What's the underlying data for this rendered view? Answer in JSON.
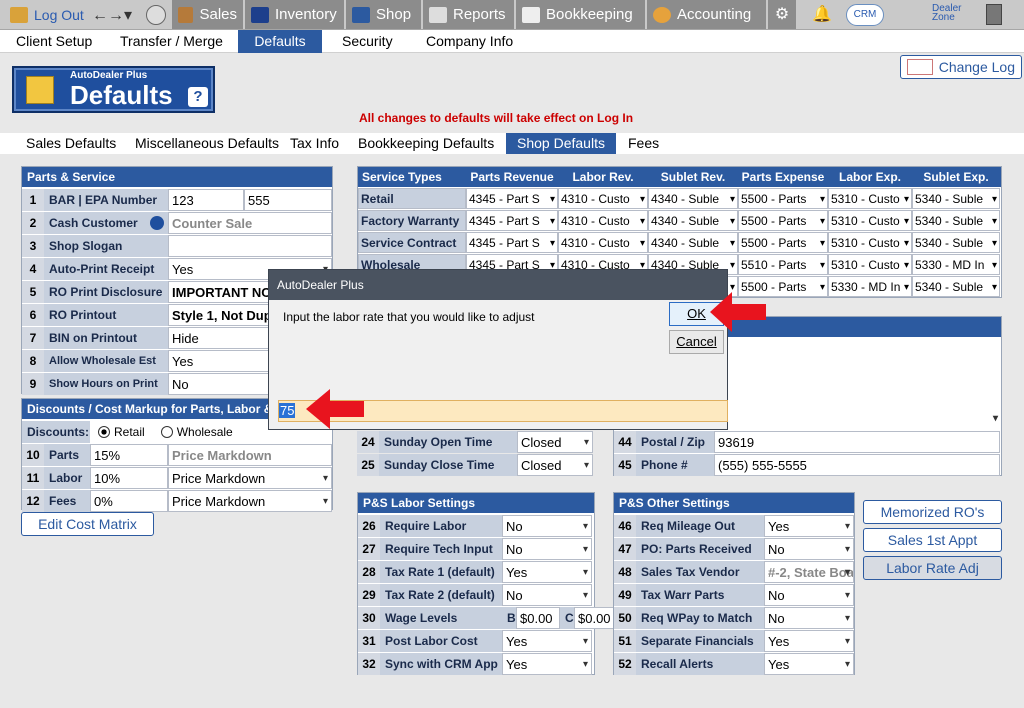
{
  "nav": {
    "logout": "Log Out",
    "sales": "Sales",
    "inventory": "Inventory",
    "shop": "Shop",
    "reports": "Reports",
    "bookkeeping": "Bookkeeping",
    "accounting": "Accounting",
    "crm": "CRM",
    "dealer_zone": "Dealer Zone"
  },
  "subtabs": [
    "Client Setup",
    "Transfer / Merge",
    "Defaults",
    "Security",
    "Company Info"
  ],
  "logo": {
    "small": "AutoDealer Plus",
    "big": "Defaults",
    "help": "?"
  },
  "notice": "All changes to defaults will take effect on Log In",
  "change_log": "Change Log",
  "deftabs": [
    "Sales Defaults",
    "Miscellaneous Defaults",
    "Tax Info",
    "Bookkeeping Defaults",
    "Shop Defaults",
    "Fees"
  ],
  "parts": {
    "title": "Parts & Service",
    "rows": [
      {
        "n": "1",
        "label": "BAR | EPA Number",
        "v1": "123",
        "v2": "555"
      },
      {
        "n": "2",
        "label": "Cash Customer",
        "value": "Counter Sale"
      },
      {
        "n": "3",
        "label": "Shop Slogan",
        "value": ""
      },
      {
        "n": "4",
        "label": "Auto-Print Receipt",
        "value": "Yes"
      },
      {
        "n": "5",
        "label": "RO Print Disclosure",
        "value": "IMPORTANT NO"
      },
      {
        "n": "6",
        "label": "RO Printout",
        "value": "Style 1, Not Dup"
      },
      {
        "n": "7",
        "label": "BIN on Printout",
        "value": "Hide"
      },
      {
        "n": "8",
        "label": "Allow Wholesale Est",
        "value": "Yes"
      },
      {
        "n": "9",
        "label": "Show Hours on Print",
        "value": "No"
      }
    ]
  },
  "discounts": {
    "title": "Discounts / Cost Markup for Parts, Labor &",
    "label": "Discounts:",
    "retail": "Retail",
    "wholesale": "Wholesale",
    "rows": [
      {
        "n": "10",
        "label": "Parts",
        "pct": "15%",
        "mode": "Price Markdown"
      },
      {
        "n": "11",
        "label": "Labor",
        "pct": "10%",
        "mode": "Price Markdown"
      },
      {
        "n": "12",
        "label": "Fees",
        "pct": "0%",
        "mode": "Price Markdown"
      }
    ],
    "edit_matrix": "Edit Cost Matrix"
  },
  "service": {
    "headers": [
      "Service Types",
      "Parts Revenue",
      "Labor Rev.",
      "Sublet Rev.",
      "Parts Expense",
      "Labor Exp.",
      "Sublet Exp."
    ],
    "rows": [
      [
        "Retail",
        "4345 - Part S",
        "4310 - Custo",
        "4340 - Suble",
        "5500 - Parts",
        "5310 - Custo",
        "5340 - Suble"
      ],
      [
        "Factory Warranty",
        "4345 - Part S",
        "4310 - Custo",
        "4340 - Suble",
        "5500 - Parts",
        "5310 - Custo",
        "5340 - Suble"
      ],
      [
        "Service Contract",
        "4345 - Part S",
        "4310 - Custo",
        "4340 - Suble",
        "5500 - Parts",
        "5310 - Custo",
        "5340 - Suble"
      ],
      [
        "Wholesale",
        "4345 - Part S",
        "4310 - Custo",
        "4340 - Suble",
        "5510 - Parts",
        "5310 - Custo",
        "5330 - MD In"
      ],
      [
        "",
        "",
        "",
        "",
        "5500 - Parts",
        "5330 - MD In",
        "5340 - Suble"
      ]
    ]
  },
  "hours": [
    {
      "n": "24",
      "label": "Sunday Open Time",
      "value": "Closed"
    },
    {
      "n": "25",
      "label": "Sunday Close Time",
      "value": "Closed"
    }
  ],
  "info": {
    "title": "t Info",
    "rows": [
      {
        "n": "",
        "label": "",
        "value": "hop Shop"
      },
      {
        "n": "",
        "label": "",
        "value": "3456 areg a ave"
      },
      {
        "n": "",
        "label": "",
        "value": "ovis"
      },
      {
        "n": "",
        "label": "",
        "value": "A - California"
      },
      {
        "n": "44",
        "label": "Postal / Zip",
        "value": "93619"
      },
      {
        "n": "45",
        "label": "Phone #",
        "value": "(555) 555-5555"
      }
    ]
  },
  "labor": {
    "title": "P&S Labor Settings",
    "rows": [
      {
        "n": "26",
        "label": "Require Labor",
        "value": "No"
      },
      {
        "n": "27",
        "label": "Require Tech Input",
        "value": "No"
      },
      {
        "n": "28",
        "label": "Tax Rate 1 (default)",
        "value": "Yes"
      },
      {
        "n": "29",
        "label": "Tax Rate 2 (default)",
        "value": "No"
      },
      {
        "n": "30",
        "label": "Wage Levels",
        "b": "B",
        "bval": "$0.00",
        "c": "C",
        "cval": "$0.00"
      },
      {
        "n": "31",
        "label": "Post Labor Cost",
        "value": "Yes"
      },
      {
        "n": "32",
        "label": "Sync with CRM App",
        "value": "Yes"
      }
    ]
  },
  "other": {
    "title": "P&S Other Settings",
    "rows": [
      {
        "n": "46",
        "label": "Req Mileage Out",
        "value": "Yes"
      },
      {
        "n": "47",
        "label": "PO: Parts Received",
        "value": "No"
      },
      {
        "n": "48",
        "label": "Sales Tax Vendor",
        "value": "#-2, State Boa"
      },
      {
        "n": "49",
        "label": "Tax Warr Parts",
        "value": "No"
      },
      {
        "n": "50",
        "label": "Req WPay to Match",
        "value": "No"
      },
      {
        "n": "51",
        "label": "Separate Financials",
        "value": "Yes"
      },
      {
        "n": "52",
        "label": "Recall Alerts",
        "value": "Yes"
      }
    ]
  },
  "side_buttons": [
    "Memorized RO's",
    "Sales 1st Appt",
    "Labor Rate Adj"
  ],
  "dialog": {
    "title": "AutoDealer Plus",
    "message": "Input the labor rate that you would like to adjust",
    "ok": "OK",
    "cancel": "Cancel",
    "input": "75"
  },
  "colors": {
    "accent": "#2c5aa0",
    "arrow": "#e8141e"
  }
}
